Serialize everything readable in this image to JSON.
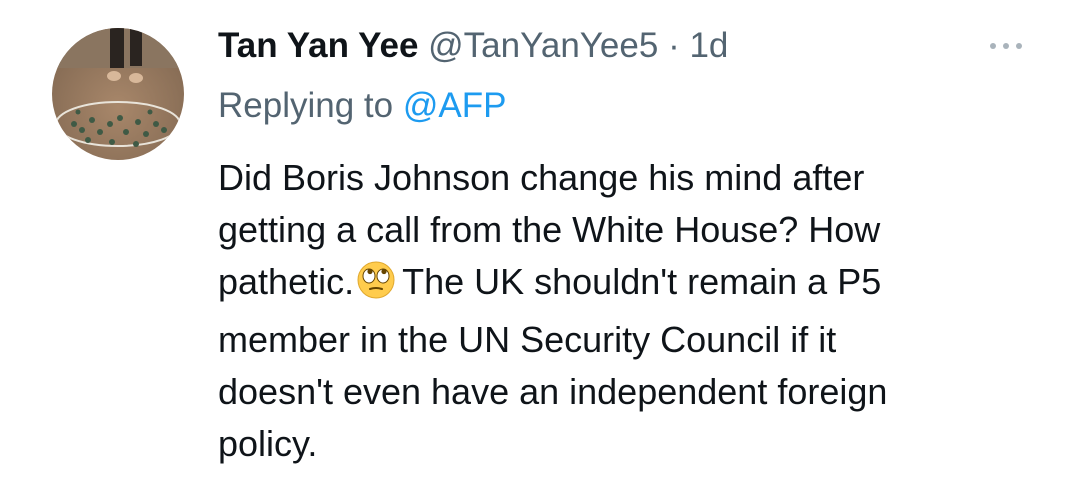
{
  "tweet": {
    "author_name": "Tan Yan Yee",
    "author_handle": "@TanYanYee5",
    "separator": "·",
    "time": "1d",
    "reply_prefix": "Replying to",
    "reply_handle": "@AFP",
    "body_lines": {
      "l1": "Did Boris Johnson change his mind after",
      "l2": "getting a call from the White House? How",
      "l3a": "pathetic.",
      "l3b": "The UK shouldn't remain a P5",
      "l4": "member in the UN Security Council if it",
      "l5": "doesn't even have an independent foreign",
      "l6": "policy."
    },
    "emoji": "face-with-rolling-eyes",
    "more_icon": "ellipsis-icon"
  },
  "colors": {
    "text": "#0f1419",
    "secondary": "#536471",
    "link": "#1d9bf0",
    "more_dots": "#a9b3bb"
  }
}
